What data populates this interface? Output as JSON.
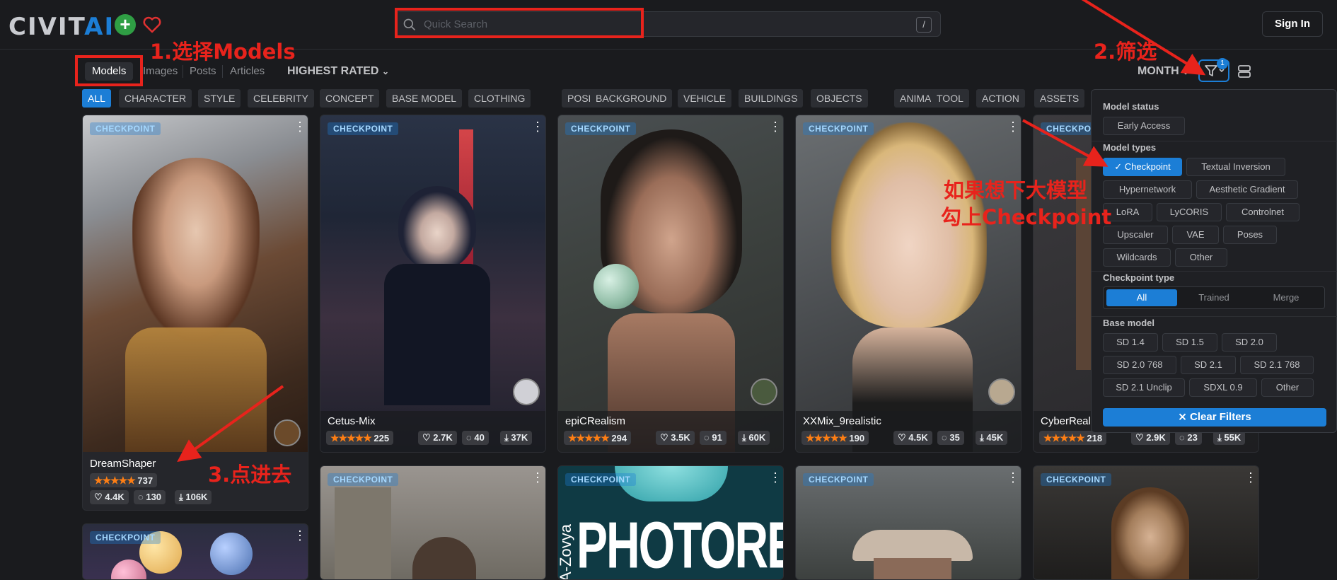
{
  "header": {
    "logo_text": "CIVIT",
    "logo_ai": "AI",
    "search_placeholder": "Quick Search",
    "search_shortcut": "/",
    "signin_label": "Sign In"
  },
  "nav": {
    "tabs": [
      "Models",
      "Images",
      "Posts",
      "Articles"
    ],
    "sort": "HIGHEST RATED",
    "period": "MONTH",
    "filter_count": "1"
  },
  "categories": [
    "ALL",
    "CHARACTER",
    "STYLE",
    "CELEBRITY",
    "CONCEPT",
    "BASE MODEL",
    "CLOTHING",
    "POSES",
    "BACKGROUND",
    "VEHICLE",
    "BUILDINGS",
    "OBJECTS",
    "ANIMAL",
    "TOOL",
    "ACTION",
    "ASSETS"
  ],
  "annotations": {
    "step1": "1.选择Models",
    "step2": "2.筛选",
    "step3": "3.点进去",
    "hint_line1": "如果想下大模型",
    "hint_line2": "勾上Checkpoint"
  },
  "cards": [
    {
      "badge": "CHECKPOINT",
      "title": "DreamShaper",
      "rating": "737",
      "likes": "4.4K",
      "comments": "130",
      "downloads": "106K"
    },
    {
      "badge": "CHECKPOINT",
      "title": "Cetus-Mix",
      "rating": "225",
      "likes": "2.7K",
      "comments": "40",
      "downloads": "37K"
    },
    {
      "badge": "CHECKPOINT",
      "title": "epiCRealism",
      "rating": "294",
      "likes": "3.5K",
      "comments": "91",
      "downloads": "60K"
    },
    {
      "badge": "CHECKPOINT",
      "title": "XXMix_9realistic",
      "rating": "190",
      "likes": "4.5K",
      "comments": "35",
      "downloads": "45K"
    },
    {
      "badge": "CHECKPOINT",
      "title": "CyberReali",
      "rating": "218",
      "likes": "2.9K",
      "comments": "23",
      "downloads": "55K"
    },
    {
      "badge": "CHECKPOINT"
    },
    {
      "badge": "CHECKPOINT"
    },
    {
      "badge": "CHECKPOINT",
      "poster_text": "PHOTOREAL",
      "poster_side": "A-Zovya"
    },
    {
      "badge": "CHECKPOINT"
    },
    {
      "badge": "CHECKPOINT"
    }
  ],
  "filters": {
    "model_status_title": "Model status",
    "model_status": [
      "Early Access"
    ],
    "model_types_title": "Model types",
    "model_types": [
      "Checkpoint",
      "Textual Inversion",
      "Hypernetwork",
      "Aesthetic Gradient",
      "LoRA",
      "LyCORIS",
      "Controlnet",
      "Upscaler",
      "VAE",
      "Poses",
      "Wildcards",
      "Other"
    ],
    "checkpoint_type_title": "Checkpoint type",
    "checkpoint_types": [
      "All",
      "Trained",
      "Merge"
    ],
    "base_model_title": "Base model",
    "base_models": [
      "SD 1.4",
      "SD 1.5",
      "SD 2.0",
      "SD 2.0 768",
      "SD 2.1",
      "SD 2.1 768",
      "SD 2.1 Unclip",
      "SDXL 0.9",
      "Other"
    ],
    "clear_label": "Clear Filters"
  }
}
